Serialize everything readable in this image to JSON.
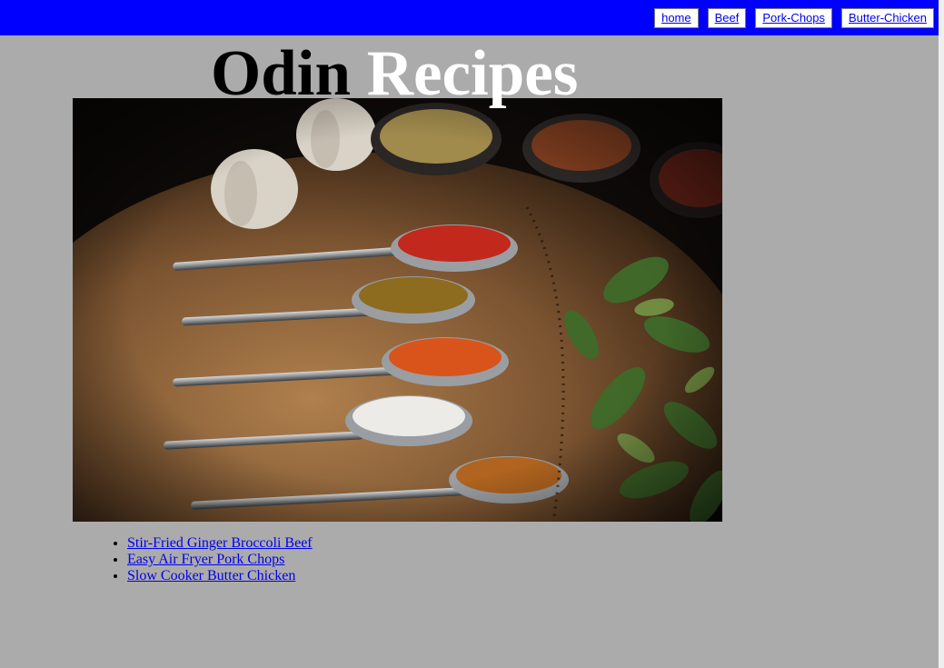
{
  "nav": {
    "items": [
      {
        "label": "home"
      },
      {
        "label": "Beef"
      },
      {
        "label": "Pork-Chops"
      },
      {
        "label": "Butter-Chicken"
      }
    ]
  },
  "header": {
    "title_part1": "Odin",
    "title_part2": "Recipes"
  },
  "hero": {
    "description": "spices-on-spoons-photo"
  },
  "recipes": {
    "items": [
      {
        "label": "Stir-Fried Ginger Broccoli Beef"
      },
      {
        "label": "Easy Air Fryer Pork Chops"
      },
      {
        "label": "Slow Cooker Butter Chicken"
      }
    ]
  },
  "colors": {
    "topbar": "#0000ff",
    "background": "#ababab",
    "link": "#0000ee"
  }
}
